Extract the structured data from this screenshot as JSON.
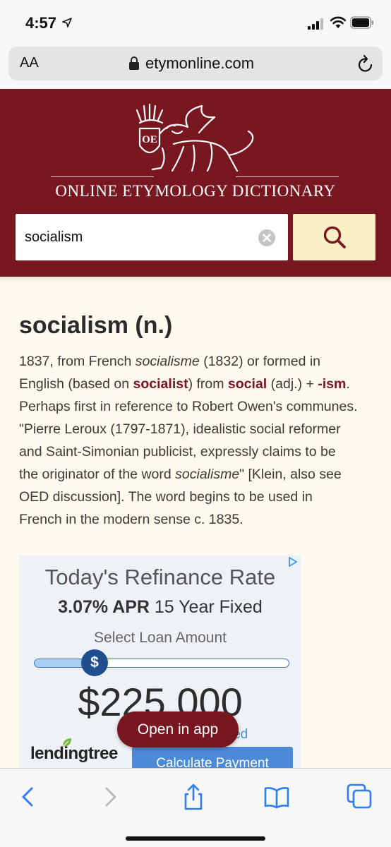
{
  "status_bar": {
    "time": "4:57"
  },
  "browser": {
    "text_size_label": "AA",
    "url": "etymonline.com"
  },
  "site": {
    "name": "ONLINE ETYMOLOGY DICTIONARY",
    "logo_initials": "OE"
  },
  "search": {
    "value": "socialism"
  },
  "entry": {
    "title": "socialism (n.)",
    "body": {
      "p1": "1837, from French ",
      "p2": "socialisme",
      "p3": " (1832) or formed in English (based on ",
      "link_socialist": "socialist",
      "p4": ") from ",
      "link_social": "social",
      "p5": " (adj.) + ",
      "link_ism": "-ism",
      "p6": ". Perhaps first in reference to Robert Owen's communes. \"Pierre Leroux (1797-1871), idealistic social reformer and Saint-Simonian publicist, expressly claims to be the originator of the word ",
      "p7": "socialisme",
      "p8": "\" [Klein, also see OED discussion]. The word begins to be used in French in the modern sense c. 1835."
    }
  },
  "ad": {
    "headline": "Today's Refinance Rate",
    "rate_bold": "3.07% APR",
    "rate_rest": " 15 Year Fixed",
    "select_label": "Select Loan Amount",
    "slider_symbol": "$",
    "slider_level": 0.23,
    "amount": "$225,000",
    "required_text": "uired",
    "brand": "lendingtree",
    "cta": "Calculate Payment"
  },
  "open_in_app": "Open in app",
  "colors": {
    "brand": "#791721",
    "search_button": "#fbf0c5",
    "ad_blue": "#4c89d6"
  }
}
